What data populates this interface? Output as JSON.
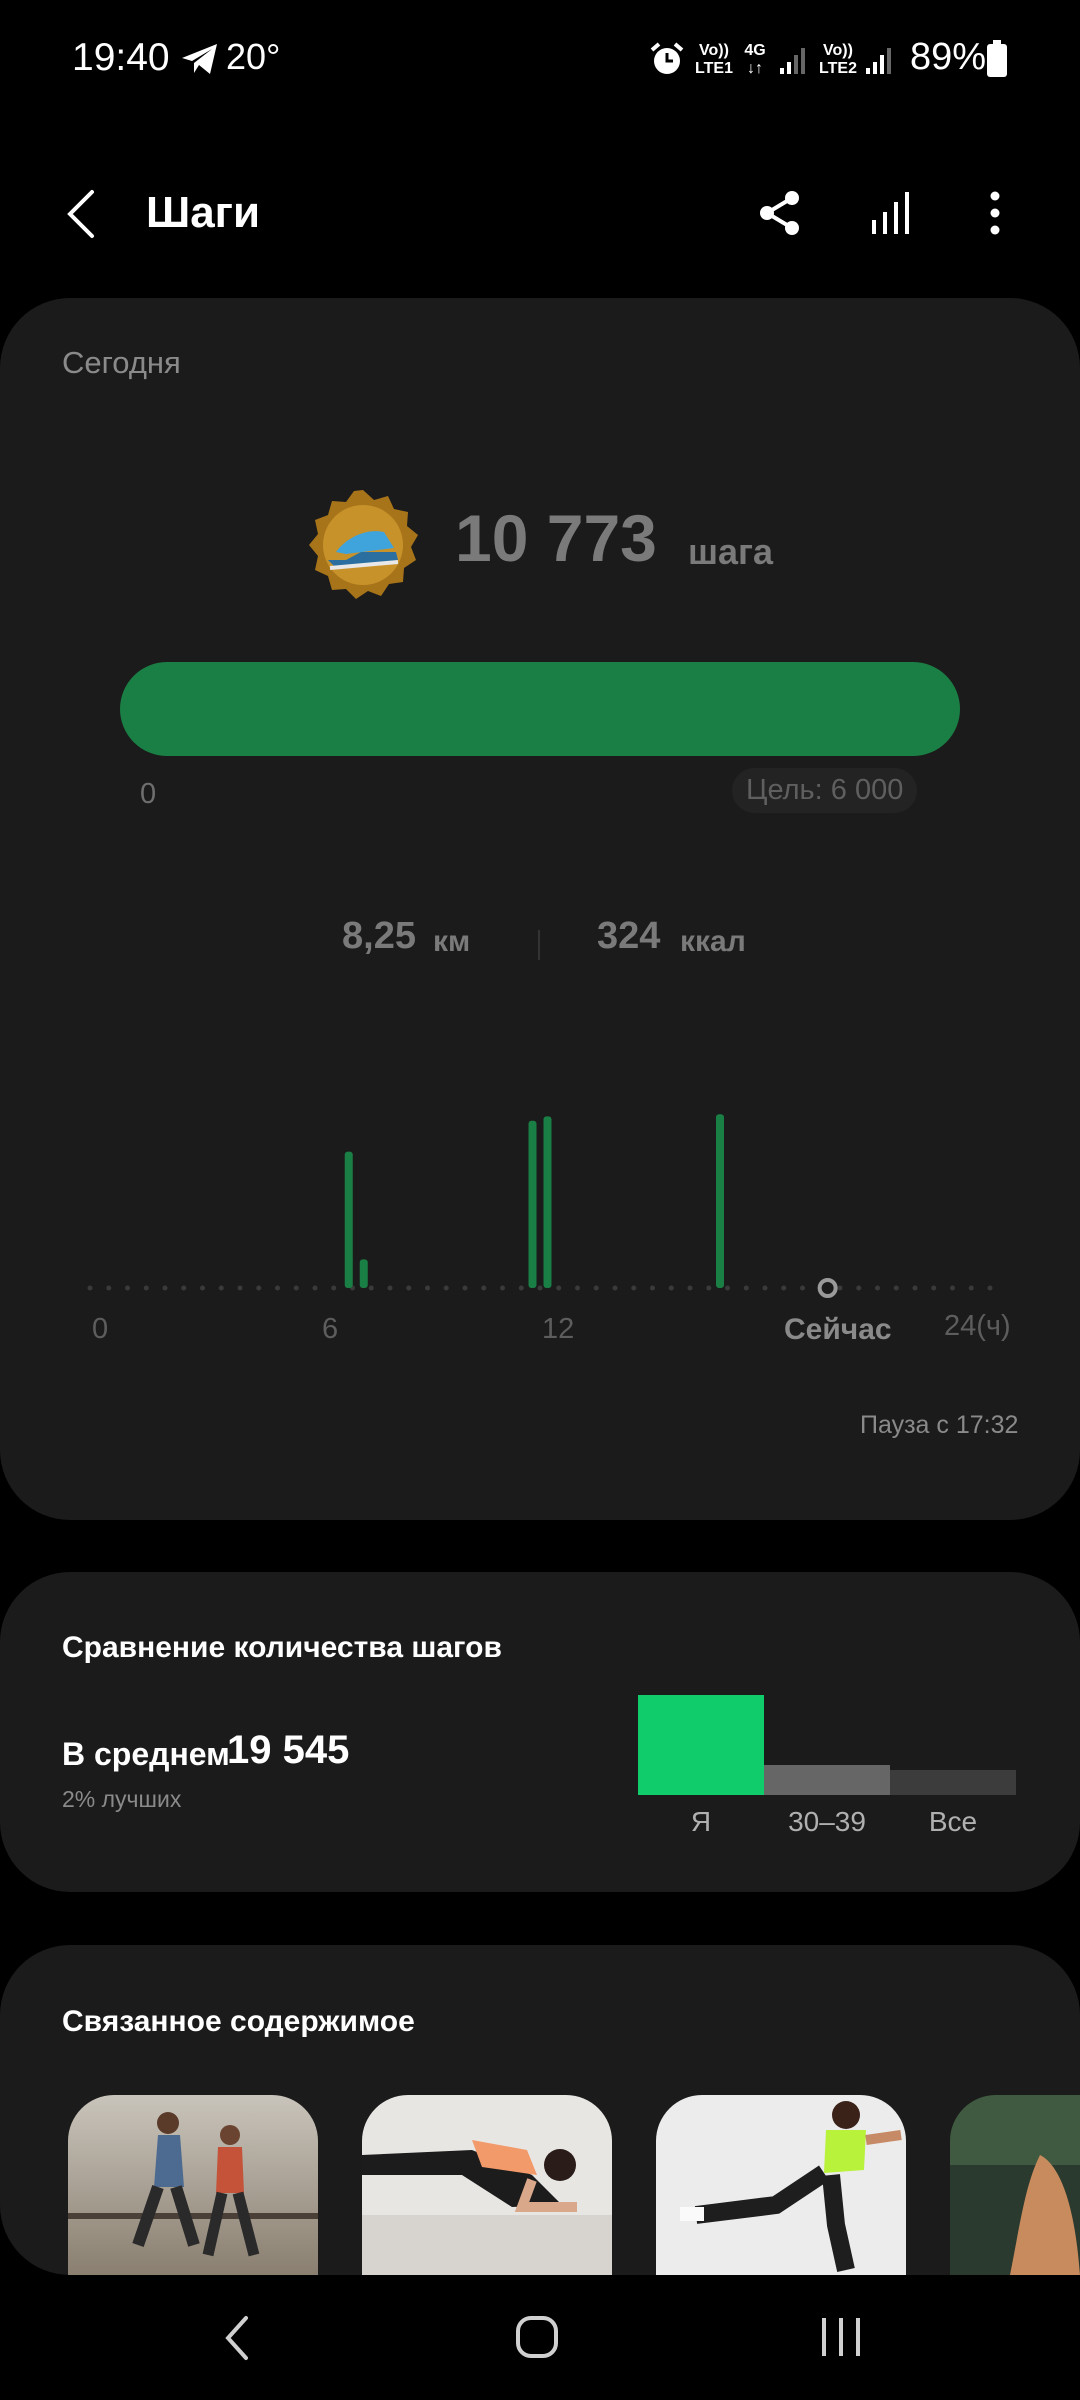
{
  "status_bar": {
    "time": "19:40",
    "temperature": "20°",
    "lte1_top": "Vo))",
    "lte1_bottom": "LTE1",
    "net_type": "4G",
    "lte2_top": "Vo))",
    "lte2_bottom": "LTE2",
    "battery": "89%"
  },
  "header": {
    "title": "Шаги"
  },
  "today_card": {
    "label": "Сегодня",
    "steps_value": "10 773",
    "steps_unit": "шага",
    "progress_fraction": 1.0,
    "progress_start": "0",
    "goal_label": "Цель: 6 000",
    "distance_value": "8,25",
    "distance_unit": "км",
    "calories_value": "324",
    "calories_unit": "ккал",
    "pause_text": "Пауза с 17:32"
  },
  "chart_data": {
    "type": "bar",
    "x": [
      6.9,
      7.3,
      11.8,
      12.2,
      16.8
    ],
    "values": [
      0.62,
      0.13,
      0.76,
      0.78,
      0.79
    ],
    "x_range": [
      0,
      24
    ],
    "now_hour": 19.67,
    "tick_labels": [
      "0",
      "6",
      "12",
      "Сейчас",
      "24(ч)"
    ],
    "color": "#1a7f45"
  },
  "comparison": {
    "title": "Сравнение количества шагов",
    "avg_label": "В среднем",
    "avg_value": "19 545",
    "better_text": "2% лучших",
    "bars": [
      {
        "label": "Я",
        "value": 1.0,
        "color": "#11cc6a"
      },
      {
        "label": "30–39",
        "value": 0.3,
        "color": "#666666"
      },
      {
        "label": "Все",
        "value": 0.25,
        "color": "#3c3c3c"
      }
    ]
  },
  "related": {
    "title": "Связанное содержимое"
  },
  "colors": {
    "accent_green": "#1a7f45",
    "bright_green": "#11cc6a",
    "card_bg": "#1b1b1b"
  }
}
